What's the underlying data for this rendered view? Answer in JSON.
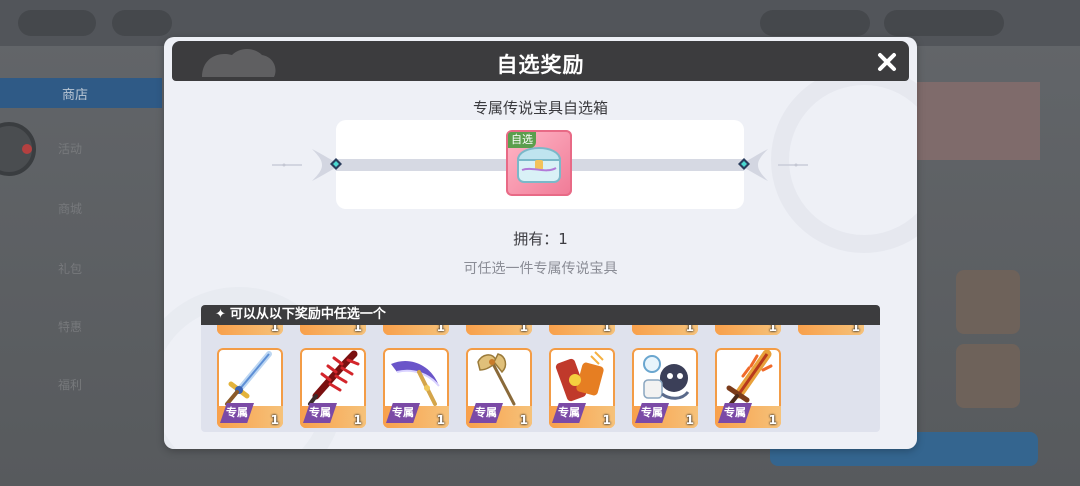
{
  "background": {
    "tab_label": "商店",
    "side_items": [
      "活动",
      "商城",
      "礼包",
      "特惠",
      "福利"
    ]
  },
  "dialog": {
    "title": "自选奖励",
    "box_name": "专属传说宝具自选箱",
    "box_tag": "自选",
    "owned_label": "拥有：1",
    "hint": "可任选一件专属传说宝具",
    "rewards_header": "可以从以下奖励中任选一个"
  },
  "rewards": {
    "partial_row": [
      {
        "qty": "1"
      },
      {
        "qty": "1"
      },
      {
        "qty": "1"
      },
      {
        "qty": "1"
      },
      {
        "qty": "1"
      },
      {
        "qty": "1"
      },
      {
        "qty": "1"
      },
      {
        "qty": "1"
      }
    ],
    "items": [
      {
        "badge": "专属",
        "qty": "1",
        "icon": "sapphire-sword-icon"
      },
      {
        "badge": "专属",
        "qty": "1",
        "icon": "crimson-spine-blade-icon"
      },
      {
        "badge": "专属",
        "qty": "1",
        "icon": "violet-scythe-icon"
      },
      {
        "badge": "专属",
        "qty": "1",
        "icon": "golden-axe-staff-icon"
      },
      {
        "badge": "专属",
        "qty": "1",
        "icon": "fire-cannon-icon"
      },
      {
        "badge": "专属",
        "qty": "1",
        "icon": "companion-bot-icon"
      },
      {
        "badge": "专属",
        "qty": "1",
        "icon": "flame-greatsword-icon"
      }
    ]
  },
  "colors": {
    "header_bg": "#3c3c3e",
    "dialog_bg": "#eef0f6",
    "cell_border": "#f39c46",
    "badge_purple": "#7b4aa6"
  }
}
